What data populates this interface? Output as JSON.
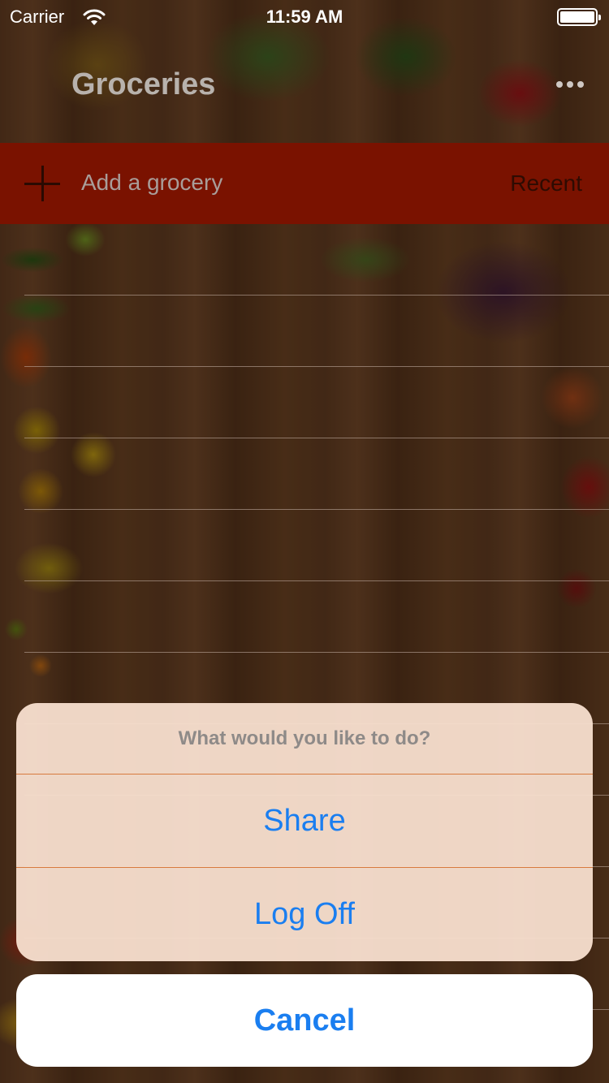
{
  "status_bar": {
    "carrier": "Carrier",
    "time": "11:59 AM",
    "icons": [
      "wifi-icon",
      "battery-icon"
    ]
  },
  "nav": {
    "title": "Groceries",
    "more_icon": "more-icon"
  },
  "add_bar": {
    "icon": "plus-icon",
    "placeholder": "Add a grocery",
    "recent_label": "Recent"
  },
  "action_sheet": {
    "title": "What would you like to do?",
    "actions": [
      "Share",
      "Log Off"
    ],
    "cancel_label": "Cancel"
  },
  "colors": {
    "accent": "#1a7ef0",
    "add_bar": "#7a1200"
  }
}
